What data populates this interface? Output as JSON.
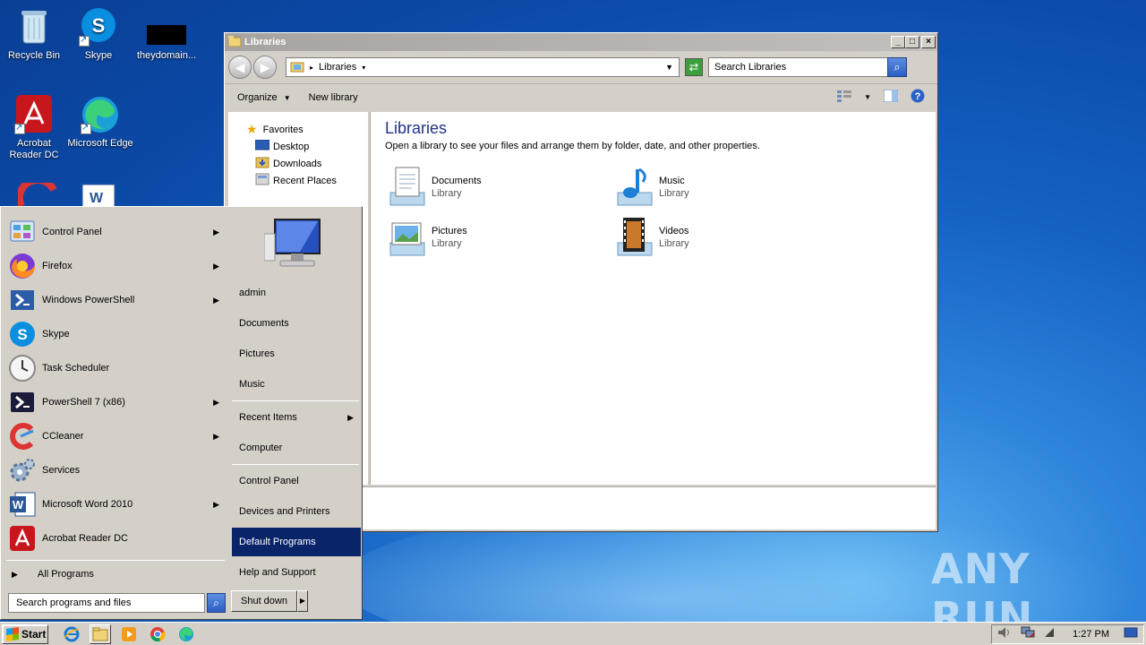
{
  "desktop": {
    "icons": [
      {
        "label": "Recycle Bin",
        "icon": "recycle-bin-icon"
      },
      {
        "label": "Skype",
        "icon": "skype-icon"
      },
      {
        "label": "theydomain...",
        "icon": "file-icon"
      },
      {
        "label": "Acrobat Reader DC",
        "icon": "acrobat-icon"
      },
      {
        "label": "Microsoft Edge",
        "icon": "edge-icon"
      }
    ],
    "watermark": "ANY RUN"
  },
  "explorer": {
    "title": "Libraries",
    "address": "Libraries",
    "search_placeholder": "Search Libraries",
    "toolbar": {
      "organize": "Organize",
      "new_library": "New library"
    },
    "nav": {
      "favorites": "Favorites",
      "items": [
        "Desktop",
        "Downloads",
        "Recent Places"
      ]
    },
    "heading": "Libraries",
    "description": "Open a library to see your files and arrange them by folder, date, and other properties.",
    "libraries": [
      {
        "name": "Documents",
        "type": "Library",
        "icon": "documents-library-icon"
      },
      {
        "name": "Music",
        "type": "Library",
        "icon": "music-library-icon"
      },
      {
        "name": "Pictures",
        "type": "Library",
        "icon": "pictures-library-icon"
      },
      {
        "name": "Videos",
        "type": "Library",
        "icon": "videos-library-icon"
      }
    ]
  },
  "start_menu": {
    "programs": [
      {
        "label": "Control Panel",
        "submenu": true
      },
      {
        "label": "Firefox",
        "submenu": true
      },
      {
        "label": "Windows PowerShell",
        "submenu": true
      },
      {
        "label": "Skype",
        "submenu": false
      },
      {
        "label": "Task Scheduler",
        "submenu": false
      },
      {
        "label": "PowerShell 7 (x86)",
        "submenu": true
      },
      {
        "label": "CCleaner",
        "submenu": true
      },
      {
        "label": "Services",
        "submenu": false
      },
      {
        "label": "Microsoft Word 2010",
        "submenu": true
      },
      {
        "label": "Acrobat Reader DC",
        "submenu": false
      }
    ],
    "all_programs": "All Programs",
    "search_placeholder": "Search programs and files",
    "right": {
      "user": "admin",
      "documents": "Documents",
      "pictures": "Pictures",
      "music": "Music",
      "recent_items": "Recent Items",
      "computer": "Computer",
      "control_panel": "Control Panel",
      "devices_printers": "Devices and Printers",
      "default_programs": "Default Programs",
      "help_support": "Help and Support"
    },
    "shutdown": "Shut down"
  },
  "taskbar": {
    "start": "Start",
    "clock": "1:27 PM",
    "pinned": [
      "internet-explorer-icon",
      "explorer-icon",
      "media-player-icon",
      "chrome-icon",
      "edge-icon"
    ]
  }
}
